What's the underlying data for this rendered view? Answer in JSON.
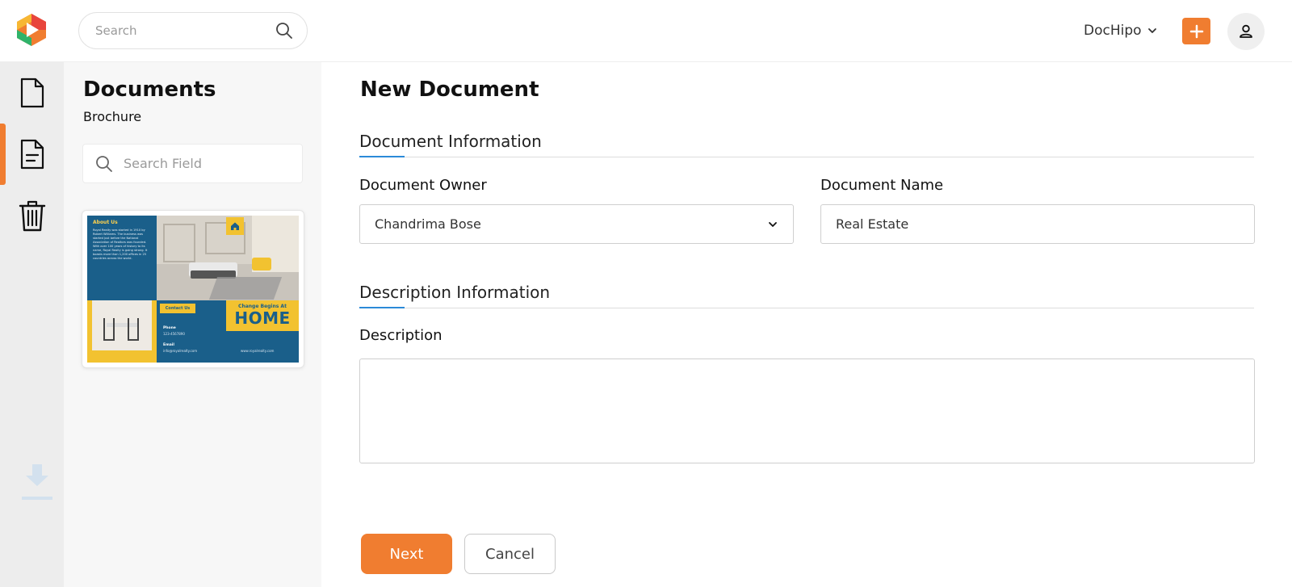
{
  "app": {
    "search_placeholder": "Search",
    "workspace_label": "DocHipo",
    "colors": {
      "accent": "#f07d30",
      "section_accent": "#2b8ad8"
    }
  },
  "rail": {
    "items": [
      {
        "name": "documents",
        "icon": "document-icon",
        "active": false
      },
      {
        "name": "document-list",
        "icon": "document-lines-icon",
        "active": true
      },
      {
        "name": "trash",
        "icon": "trash-icon",
        "active": false
      }
    ],
    "download_icon": "download-icon"
  },
  "docs_panel": {
    "title": "Documents",
    "subtitle": "Brochure",
    "search_placeholder": "Search Field",
    "thumbnail": {
      "about_heading": "About Us",
      "about_text": "Royal Realty was started in 1910 by Robert Williams. The business was started just before the National Association of Realtors was founded. With over 100 years of history to its name, Royal Realty is going strong. It boasts more than 1,200 offices in 25 countries across the world.",
      "contact_heading": "Contact Us",
      "phone_label": "Phone",
      "phone_value": "123-4567890",
      "email_label": "Email",
      "email_value": "info@royalrealty.com",
      "tagline": "Change Begins At",
      "headline": "HOME",
      "website": "www.royalrealty.com"
    }
  },
  "form": {
    "title": "New Document",
    "section_document": "Document Information",
    "owner_label": "Document Owner",
    "owner_value": "Chandrima Bose",
    "name_label": "Document Name",
    "name_value": "Real Estate",
    "section_description": "Description Information",
    "description_label": "Description",
    "description_value": "",
    "next_label": "Next",
    "cancel_label": "Cancel"
  }
}
